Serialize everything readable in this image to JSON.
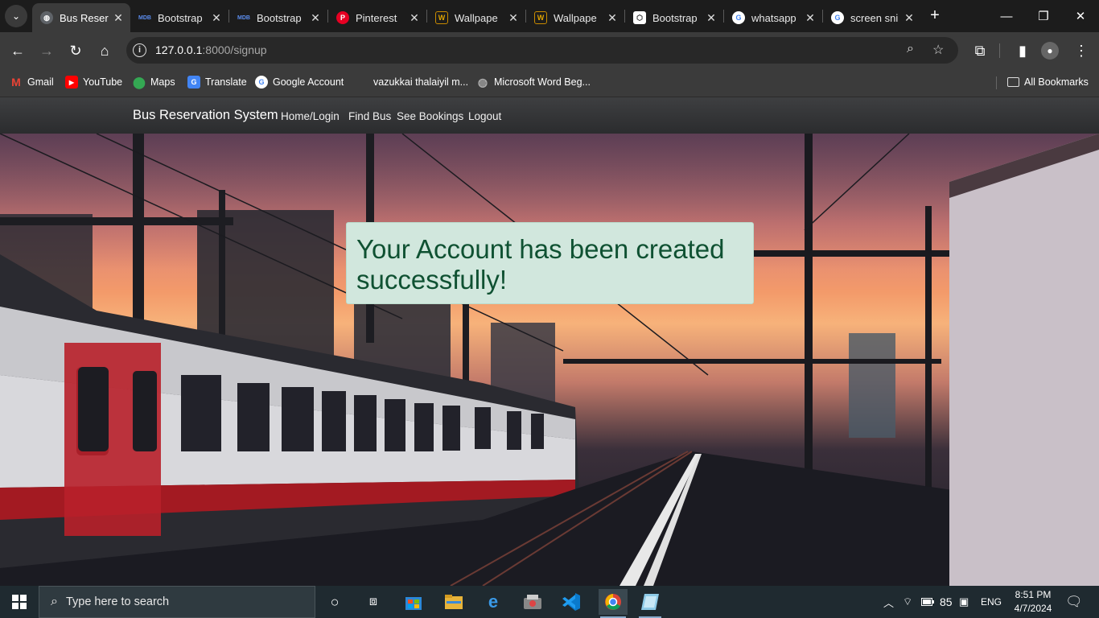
{
  "browser": {
    "tabs": [
      {
        "title": "Bus Reser",
        "favicon": "globe",
        "color": "#5f6368",
        "active": true
      },
      {
        "title": "Bootstrap",
        "favicon": "MDB",
        "color": "#1266f1",
        "active": false
      },
      {
        "title": "Bootstrap",
        "favicon": "MDB",
        "color": "#1266f1",
        "active": false
      },
      {
        "title": "Pinterest",
        "favicon": "P",
        "color": "#e60023",
        "active": false
      },
      {
        "title": "Wallpape",
        "favicon": "W",
        "color": "#c98b00",
        "active": false
      },
      {
        "title": "Wallpape",
        "favicon": "W",
        "color": "#c98b00",
        "active": false
      },
      {
        "title": "Bootstrap",
        "favicon": "B",
        "color": "#ffffff",
        "active": false
      },
      {
        "title": "whatsapp",
        "favicon": "G",
        "color": "#4285f4",
        "active": false
      },
      {
        "title": "screen sni",
        "favicon": "G",
        "color": "#4285f4",
        "active": false
      }
    ],
    "url_host": "127.0.0.1",
    "url_rest": ":8000/signup",
    "bookmarks": [
      {
        "label": "Gmail",
        "icon": "gmail-icon",
        "color": "#ea4335"
      },
      {
        "label": "YouTube",
        "icon": "youtube-icon",
        "color": "#ff0000"
      },
      {
        "label": "Maps",
        "icon": "maps-icon",
        "color": "#34a853"
      },
      {
        "label": "Translate",
        "icon": "translate-icon",
        "color": "#4285f4"
      },
      {
        "label": "Google Account",
        "icon": "google-icon",
        "color": "#4285f4"
      },
      {
        "label": "vazukkai thalaiyil m...",
        "icon": "",
        "color": ""
      },
      {
        "label": "Microsoft Word Beg...",
        "icon": "globe-icon",
        "color": "#888888"
      }
    ],
    "all_bookmarks": "All Bookmarks"
  },
  "site": {
    "brand": "Bus Reservation System",
    "nav": [
      "Home/Login",
      "Find Bus",
      "See Bookings",
      "Logout"
    ],
    "alert_message": "Your Account has been created successfully!"
  },
  "taskbar": {
    "search_placeholder": "Type here to search",
    "battery": "85",
    "language": "ENG",
    "time": "8:51 PM",
    "date": "4/7/2024"
  }
}
